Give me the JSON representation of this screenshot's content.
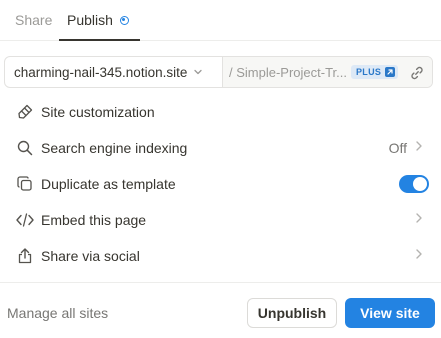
{
  "tabs": [
    {
      "label": "Share",
      "active": false
    },
    {
      "label": "Publish",
      "active": true
    }
  ],
  "url": {
    "domain": "charming-nail-345.notion.site",
    "slug": "/ Simple-Project-Tr...",
    "plus_badge": "PLUS"
  },
  "settings": [
    {
      "label": "Site customization",
      "icon": "brush-icon"
    },
    {
      "label": "Search engine indexing",
      "icon": "search-icon",
      "value": "Off"
    },
    {
      "label": "Duplicate as template",
      "icon": "duplicate-icon",
      "toggle": true
    },
    {
      "label": "Embed this page",
      "icon": "code-icon"
    },
    {
      "label": "Share via social",
      "icon": "share-icon"
    }
  ],
  "footer": {
    "manage_label": "Manage all sites",
    "unpublish_label": "Unpublish",
    "view_label": "View site"
  },
  "colors": {
    "accent": "#2383e2",
    "text": "#37352f",
    "muted": "#9b9a97",
    "plus_badge_bg": "#dde9f6",
    "plus_badge_text": "#2a78c8"
  }
}
